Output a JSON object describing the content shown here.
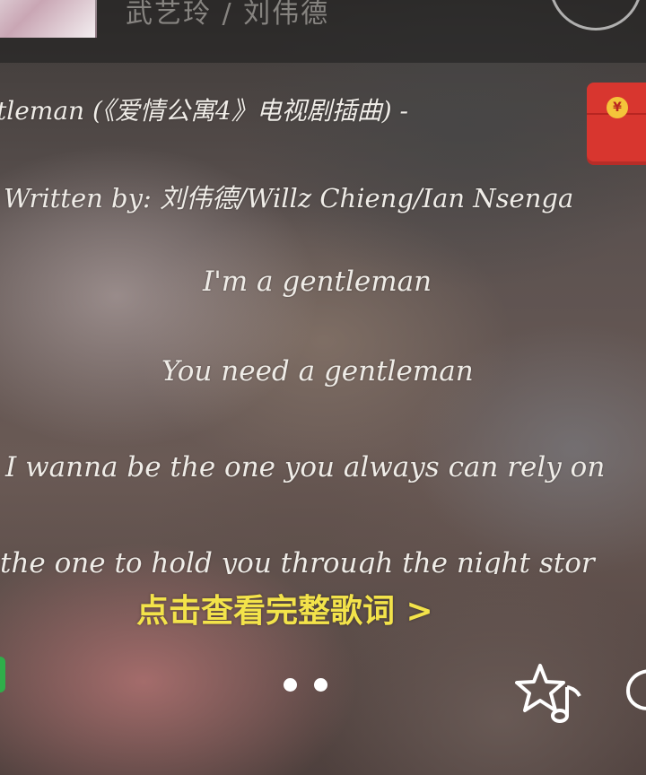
{
  "header": {
    "artists": "武艺玲 / 刘伟德"
  },
  "lyrics": {
    "song_title": "tleman (《爱情公寓4》电视剧插曲) -",
    "credit": "Written by: 刘伟德/Willz Chieng/Ian Nsenga",
    "lines": [
      "I'm a gentleman",
      "You need a gentleman",
      "I wanna be the one you always can rely on",
      "the one to hold you through the night stor"
    ],
    "view_full_label": "点击查看完整歌词 >"
  },
  "pager": {
    "page_count": 2
  },
  "actions": {
    "favorite_icon": "star-note-icon",
    "comment_icon": "comment-icon"
  },
  "colors": {
    "accent_yellow": "#f3e34a",
    "red_packet": "#d8362f"
  }
}
